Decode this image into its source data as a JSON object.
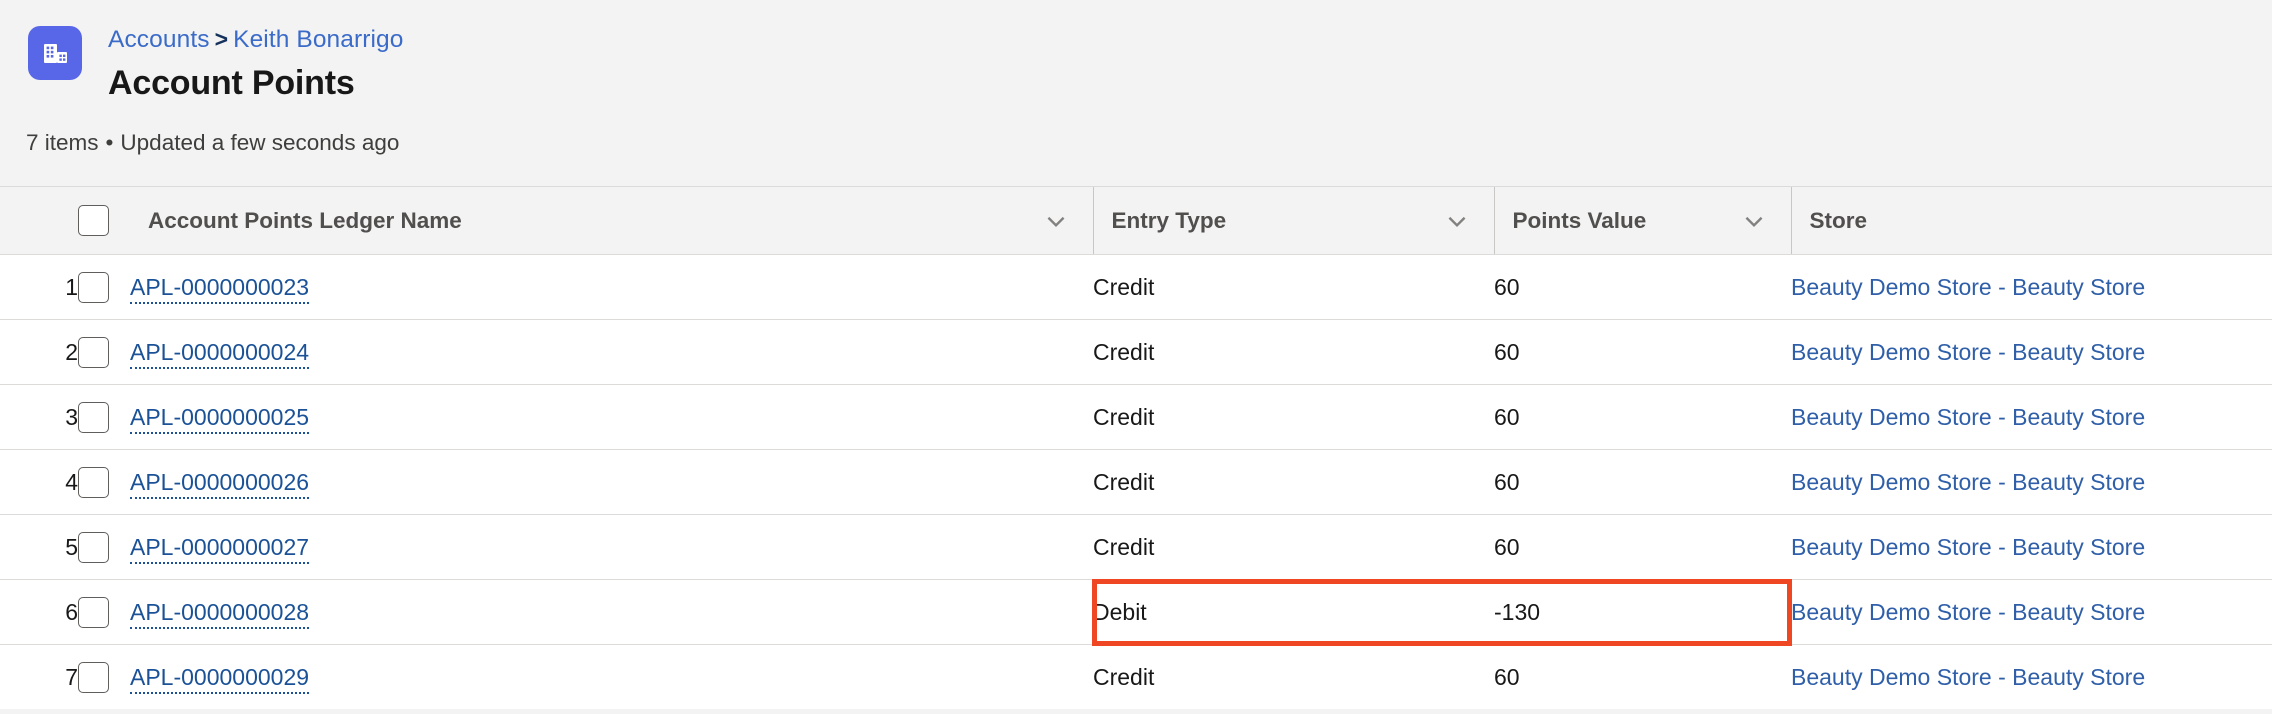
{
  "header": {
    "icon": "account-building-icon",
    "icon_bg": "#5867e8",
    "breadcrumb": {
      "parent": "Accounts",
      "separator": ">",
      "current": "Keith Bonarrigo"
    },
    "title": "Account Points",
    "meta": {
      "count": "7 items",
      "dot": "•",
      "updated": "Updated a few seconds ago"
    }
  },
  "table": {
    "select_all_checkbox": "",
    "columns": [
      {
        "key": "name",
        "label": "Account Points Ledger Name",
        "has_menu": true
      },
      {
        "key": "entry",
        "label": "Entry Type",
        "has_menu": true
      },
      {
        "key": "points",
        "label": "Points Value",
        "has_menu": true
      },
      {
        "key": "store",
        "label": "Store",
        "has_menu": false
      }
    ],
    "rows": [
      {
        "num": "1",
        "name": "APL-0000000023",
        "entry": "Credit",
        "points": "60",
        "store": "Beauty Demo Store - Beauty Store"
      },
      {
        "num": "2",
        "name": "APL-0000000024",
        "entry": "Credit",
        "points": "60",
        "store": "Beauty Demo Store - Beauty Store"
      },
      {
        "num": "3",
        "name": "APL-0000000025",
        "entry": "Credit",
        "points": "60",
        "store": "Beauty Demo Store - Beauty Store"
      },
      {
        "num": "4",
        "name": "APL-0000000026",
        "entry": "Credit",
        "points": "60",
        "store": "Beauty Demo Store - Beauty Store"
      },
      {
        "num": "5",
        "name": "APL-0000000027",
        "entry": "Credit",
        "points": "60",
        "store": "Beauty Demo Store - Beauty Store"
      },
      {
        "num": "6",
        "name": "APL-0000000028",
        "entry": "Debit",
        "points": "-130",
        "store": "Beauty Demo Store - Beauty Store"
      },
      {
        "num": "7",
        "name": "APL-0000000029",
        "entry": "Credit",
        "points": "60",
        "store": "Beauty Demo Store - Beauty Store"
      }
    ]
  },
  "annotation": {
    "type": "highlight-rectangle",
    "color": "#ef4724",
    "target_row": "6",
    "target_columns": "Entry Type, Points Value"
  },
  "colors": {
    "link": "#1b5297",
    "breadcrumb_link": "#3b6bc9",
    "header_bg": "#f3f3f3",
    "row_border": "#dddbda",
    "text": "#181818",
    "highlight": "#ef4724"
  }
}
